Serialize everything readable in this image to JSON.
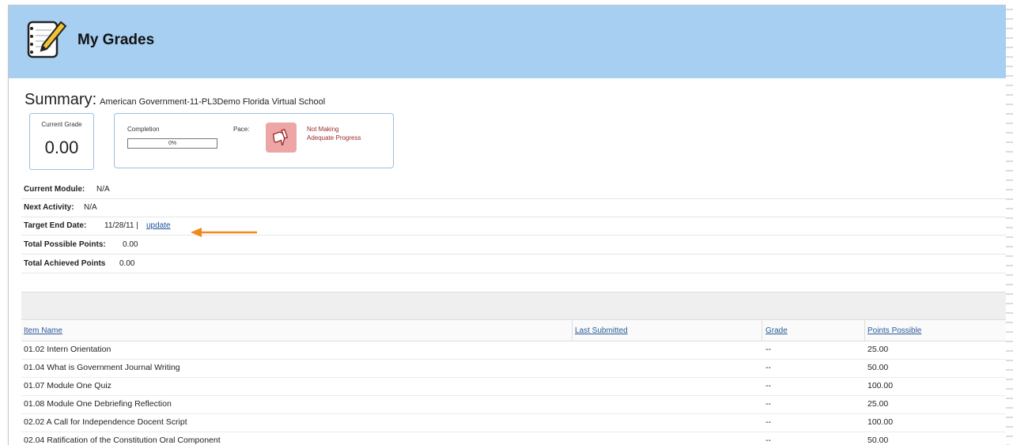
{
  "header": {
    "title": "My Grades",
    "icon": "notepad-pencil-icon",
    "color": "#a7cff2"
  },
  "summary": {
    "label": "Summary:",
    "course": "American Government-11-PL3Demo Florida Virtual School"
  },
  "current_grade": {
    "caption": "Current Grade",
    "value": "0.00"
  },
  "completion": {
    "label": "Completion",
    "percent_text": "0%",
    "fraction": 0
  },
  "pace": {
    "label": "Pace:",
    "icon": "thumbs-down-icon",
    "status": "Not Making Adequate Progress",
    "status_color": "#9b2a2a",
    "icon_bg": "#eda5a5"
  },
  "info": {
    "current_module_label": "Current Module:",
    "current_module_value": "N/A",
    "next_activity_label": "Next Activity:",
    "next_activity_value": "N/A",
    "target_end_label": "Target End Date:",
    "target_end_value": "11/28/11 |",
    "update_link": "update",
    "total_possible_label": "Total Possible Points:",
    "total_possible_value": "0.00",
    "total_achieved_label": "Total Achieved Points",
    "total_achieved_value": "0.00"
  },
  "annotation_arrow": {
    "icon": "left-arrow-icon",
    "color": "#f08a1c"
  },
  "table": {
    "columns": [
      "Item Name",
      "Last Submitted",
      "Grade",
      "Points Possible"
    ],
    "rows": [
      {
        "item": "01.02 Intern Orientation",
        "last": "",
        "grade": "--",
        "points": "25.00"
      },
      {
        "item": "01.04 What is Government Journal Writing",
        "last": "",
        "grade": "--",
        "points": "50.00"
      },
      {
        "item": "01.07 Module One Quiz",
        "last": "",
        "grade": "--",
        "points": "100.00"
      },
      {
        "item": "01.08 Module One Debriefing Reflection",
        "last": "",
        "grade": "--",
        "points": "25.00"
      },
      {
        "item": "02.02 A Call for Independence Docent Script",
        "last": "",
        "grade": "--",
        "points": "100.00"
      },
      {
        "item": "02.04 Ratification of the Constitution Oral Component",
        "last": "",
        "grade": "--",
        "points": "50.00"
      }
    ]
  }
}
